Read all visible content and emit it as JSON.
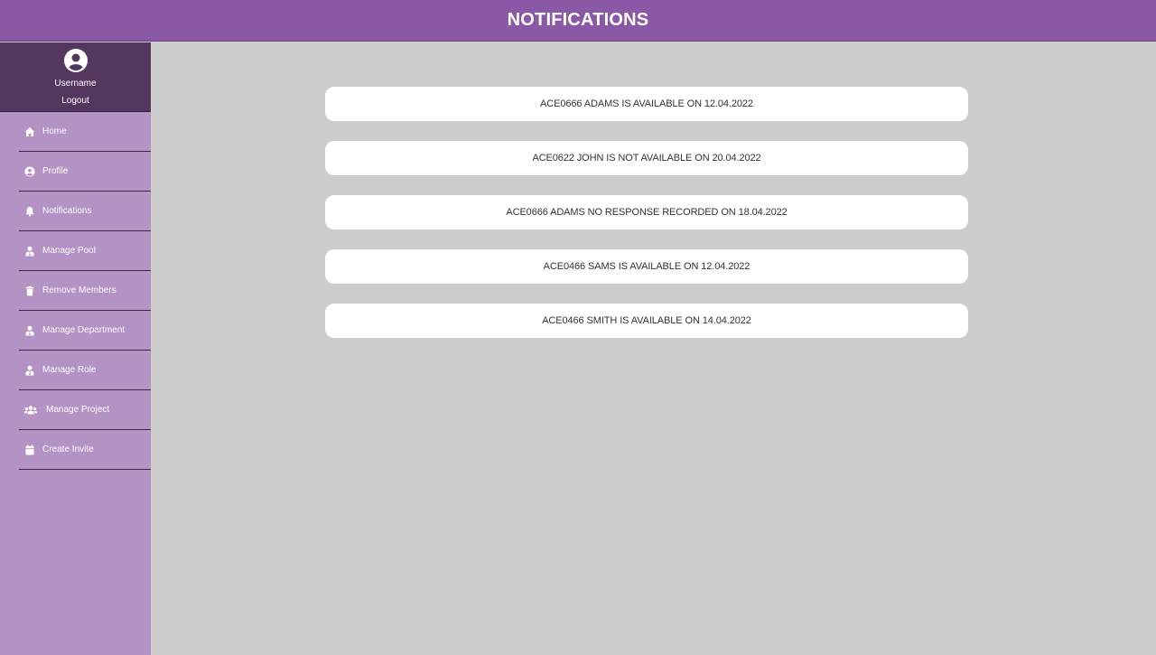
{
  "header": {
    "title": "NOTIFICATIONS"
  },
  "sidebar": {
    "user": {
      "avatar_icon": "user-circle-icon",
      "name": "Username",
      "logout_label": "Logout"
    },
    "items": [
      {
        "label": "Home",
        "icon": "home-icon"
      },
      {
        "label": "Profile",
        "icon": "user-circle-icon"
      },
      {
        "label": "Notifications",
        "icon": "bell-icon"
      },
      {
        "label": "Manage Pool",
        "icon": "user-tie-icon"
      },
      {
        "label": "Remove Members",
        "icon": "trash-icon"
      },
      {
        "label": "Manage Department",
        "icon": "user-tie-icon"
      },
      {
        "label": "Manage Role",
        "icon": "user-tie-icon"
      },
      {
        "label": "Manage Project",
        "icon": "users-icon"
      },
      {
        "label": "Create Invite",
        "icon": "calendar-icon"
      }
    ]
  },
  "notifications": [
    "ACE0666 ADAMS IS AVAILABLE ON 12.04.2022",
    "ACE0622 JOHN IS NOT AVAILABLE ON 20.04.2022",
    "ACE0666 ADAMS NO RESPONSE RECORDED ON 18.04.2022",
    "ACE0466 SAMS IS AVAILABLE ON 12.04.2022",
    "ACE0466 SMITH IS AVAILABLE ON 14.04.2022"
  ],
  "colors": {
    "header_bg": "#8a58a5",
    "sidebar_bg": "#b293c4",
    "user_box_bg": "#53375f",
    "main_bg": "#cccccc",
    "card_bg": "#ffffff"
  }
}
